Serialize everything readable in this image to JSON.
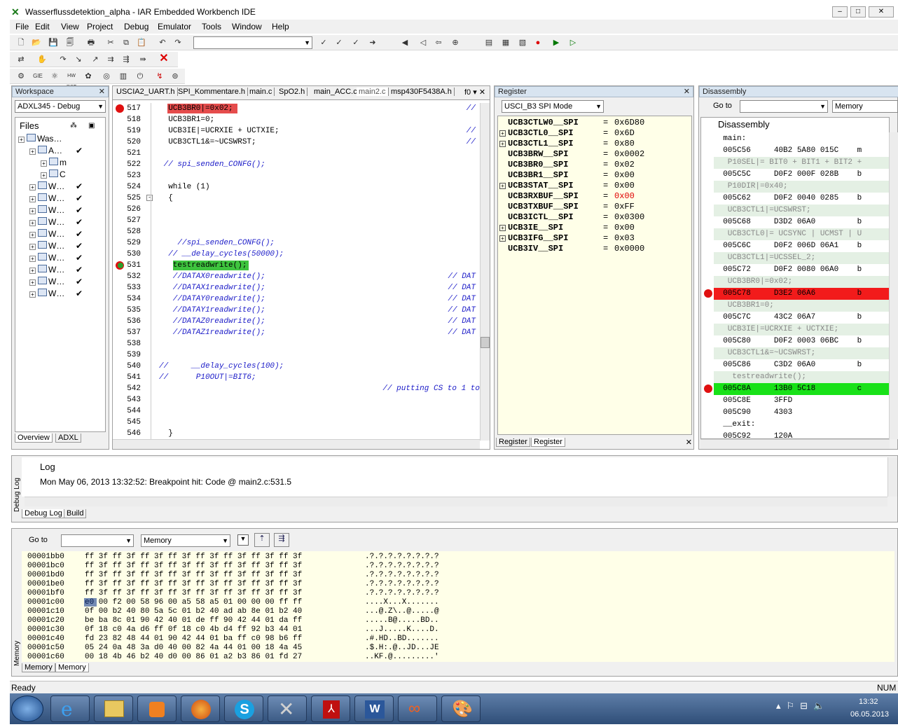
{
  "window": {
    "title": "Wasserflussdetektion_alpha - IAR Embedded Workbench IDE"
  },
  "menu": [
    "File",
    "Edit",
    "View",
    "Project",
    "Debug",
    "Emulator",
    "Tools",
    "Window",
    "Help"
  ],
  "workspace": {
    "header": "Workspace",
    "config": "ADXL345 - Debug",
    "files_label": "Files",
    "tree": [
      {
        "indent": 0,
        "label": "Was…",
        "check": ""
      },
      {
        "indent": 1,
        "label": "A…",
        "check": "✔"
      },
      {
        "indent": 2,
        "label": "m",
        "check": ""
      },
      {
        "indent": 2,
        "label": "C",
        "check": ""
      },
      {
        "indent": 1,
        "label": "W…",
        "check": "✔"
      },
      {
        "indent": 1,
        "label": "W…",
        "check": "✔"
      },
      {
        "indent": 1,
        "label": "W…",
        "check": "✔"
      },
      {
        "indent": 1,
        "label": "W…",
        "check": "✔"
      },
      {
        "indent": 1,
        "label": "W…",
        "check": "✔"
      },
      {
        "indent": 1,
        "label": "W…",
        "check": "✔"
      },
      {
        "indent": 1,
        "label": "W…",
        "check": "✔"
      },
      {
        "indent": 1,
        "label": "W…",
        "check": "✔"
      },
      {
        "indent": 1,
        "label": "W…",
        "check": "✔"
      },
      {
        "indent": 1,
        "label": "W…",
        "check": "✔"
      }
    ],
    "tabs": [
      "Overview",
      "ADXL"
    ]
  },
  "editor": {
    "tabs": [
      "USCIA2_UART.h",
      "SPI_Kommentare.h",
      "main.c",
      "SpO2.h",
      "main_ACC.c",
      "main2.c",
      "msp430F5438A.h"
    ],
    "active_tab": "main2.c",
    "func_label": "f0",
    "lines": [
      {
        "n": "517",
        "code": "  UCB3BR0|=0x02;",
        "cmt": "//",
        "mark": "bp"
      },
      {
        "n": "518",
        "code": "  UCB3BR1=0;",
        "cmt": "",
        "mark": ""
      },
      {
        "n": "519",
        "code": "  UCB3IE|=UCRXIE + UCTXIE;",
        "cmt": "//",
        "mark": ""
      },
      {
        "n": "520",
        "code": "  UCB3CTL1&=~UCSWRST;",
        "cmt": "//",
        "mark": ""
      },
      {
        "n": "521",
        "code": "",
        "cmt": "",
        "mark": ""
      },
      {
        "n": "522",
        "code": " // spi_senden_CONFG();",
        "cmt": "",
        "mark": ""
      },
      {
        "n": "523",
        "code": "",
        "cmt": "",
        "mark": ""
      },
      {
        "n": "524",
        "code": "  while (1)",
        "cmt": "",
        "mark": ""
      },
      {
        "n": "525",
        "code": "  {",
        "cmt": "",
        "mark": ""
      },
      {
        "n": "526",
        "code": "",
        "cmt": "",
        "mark": ""
      },
      {
        "n": "527",
        "code": "",
        "cmt": "",
        "mark": ""
      },
      {
        "n": "528",
        "code": "",
        "cmt": "",
        "mark": ""
      },
      {
        "n": "529",
        "code": "    //spi_senden_CONFG();",
        "cmt": "",
        "mark": ""
      },
      {
        "n": "530",
        "code": "  // __delay_cycles(50000);",
        "cmt": "",
        "mark": ""
      },
      {
        "n": "531",
        "code": "   testreadwrite();",
        "cmt": "",
        "mark": "pc"
      },
      {
        "n": "532",
        "code": "   //DATAX0readwrite();",
        "cmt": "// DAT",
        "mark": ""
      },
      {
        "n": "533",
        "code": "   //DATAX1readwrite();",
        "cmt": "// DAT",
        "mark": ""
      },
      {
        "n": "534",
        "code": "   //DATAY0readwrite();",
        "cmt": "// DAT",
        "mark": ""
      },
      {
        "n": "535",
        "code": "   //DATAY1readwrite();",
        "cmt": "// DAT",
        "mark": ""
      },
      {
        "n": "536",
        "code": "   //DATAZ0readwrite();",
        "cmt": "// DAT",
        "mark": ""
      },
      {
        "n": "537",
        "code": "   //DATAZ1readwrite();",
        "cmt": "// DAT",
        "mark": ""
      },
      {
        "n": "538",
        "code": "",
        "cmt": "",
        "mark": ""
      },
      {
        "n": "539",
        "code": "",
        "cmt": "",
        "mark": ""
      },
      {
        "n": "540",
        "code": "//     __delay_cycles(100);",
        "cmt": "",
        "mark": ""
      },
      {
        "n": "541",
        "code": "//      P10OUT|=BIT6;",
        "cmt": "",
        "mark": ""
      },
      {
        "n": "542",
        "code": "",
        "cmt": "// putting CS to 1 to",
        "mark": ""
      },
      {
        "n": "543",
        "code": "",
        "cmt": "",
        "mark": ""
      },
      {
        "n": "544",
        "code": "",
        "cmt": "",
        "mark": ""
      },
      {
        "n": "545",
        "code": "",
        "cmt": "",
        "mark": ""
      },
      {
        "n": "546",
        "code": "  }",
        "cmt": "",
        "mark": ""
      }
    ]
  },
  "register": {
    "header": "Register",
    "mode": "USCI_B3 SPI Mode",
    "rows": [
      {
        "name": "UCB3CTLW0__SPI",
        "val": "0x6D80",
        "exp": false,
        "red": false
      },
      {
        "name": "UCB3CTL0__SPI",
        "val": "0x6D",
        "exp": true,
        "red": false
      },
      {
        "name": "UCB3CTL1__SPI",
        "val": "0x80",
        "exp": true,
        "red": false
      },
      {
        "name": "UCB3BRW__SPI",
        "val": "0x0002",
        "exp": false,
        "red": false
      },
      {
        "name": "UCB3BR0__SPI",
        "val": "0x02",
        "exp": false,
        "red": false
      },
      {
        "name": "UCB3BR1__SPI",
        "val": "0x00",
        "exp": false,
        "red": false
      },
      {
        "name": "UCB3STAT__SPI",
        "val": "0x00",
        "exp": true,
        "red": false
      },
      {
        "name": "UCB3RXBUF__SPI",
        "val": "0x00",
        "exp": false,
        "red": true
      },
      {
        "name": "UCB3TXBUF__SPI",
        "val": "0xFF",
        "exp": false,
        "red": false
      },
      {
        "name": "UCB3ICTL__SPI",
        "val": "0x0300",
        "exp": false,
        "red": false
      },
      {
        "name": "UCB3IE__SPI",
        "val": "0x00",
        "exp": true,
        "red": false
      },
      {
        "name": "UCB3IFG__SPI",
        "val": "0x03",
        "exp": true,
        "red": false
      },
      {
        "name": "UCB3IV__SPI",
        "val": "0x0000",
        "exp": false,
        "red": false
      }
    ],
    "tabs": [
      "Register",
      "Register"
    ]
  },
  "disassembly": {
    "header": "Disassembly",
    "goto_label": "Go to",
    "memory_label": "Memory",
    "title": "Disassembly",
    "rows": [
      {
        "t": "  main:",
        "kind": "label"
      },
      {
        "t": "  005C56     40B2 5A80 015C    m",
        "kind": "code"
      },
      {
        "t": "   P10SEL|= BIT0 + BIT1 + BIT2 +",
        "kind": "src"
      },
      {
        "t": "  005C5C     D0F2 000F 028B    b",
        "kind": "code"
      },
      {
        "t": "   P10DIR|=0x40;",
        "kind": "src"
      },
      {
        "t": "  005C62     D0F2 0040 0285    b",
        "kind": "code"
      },
      {
        "t": "   UCB3CTL1|=UCSWRST;",
        "kind": "src"
      },
      {
        "t": "  005C68     D3D2 06A0         b",
        "kind": "code"
      },
      {
        "t": "   UCB3CTL0|= UCSYNC | UCMST | U",
        "kind": "src"
      },
      {
        "t": "  005C6C     D0F2 006D 06A1    b",
        "kind": "code"
      },
      {
        "t": "   UCB3CTL1|=UCSSEL_2;",
        "kind": "src"
      },
      {
        "t": "  005C72     D0F2 0080 06A0    b",
        "kind": "code"
      },
      {
        "t": "   UCB3BR0|=0x02;",
        "kind": "src"
      },
      {
        "t": "  005C78     D3E2 06A6         b",
        "kind": "bp"
      },
      {
        "t": "   UCB3BR1=0;",
        "kind": "src"
      },
      {
        "t": "  005C7C     43C2 06A7         b",
        "kind": "code"
      },
      {
        "t": "   UCB3IE|=UCRXIE + UCTXIE;",
        "kind": "src"
      },
      {
        "t": "  005C80     D0F2 0003 06BC    b",
        "kind": "code"
      },
      {
        "t": "   UCB3CTL1&=~UCSWRST;",
        "kind": "src"
      },
      {
        "t": "  005C86     C3D2 06A0         b",
        "kind": "code"
      },
      {
        "t": "    testreadwrite();",
        "kind": "src"
      },
      {
        "t": "  005C8A     13B0 5C18         c",
        "kind": "pc"
      },
      {
        "t": "  005C8E     3FFD",
        "kind": "code"
      },
      {
        "t": "  005C90     4303",
        "kind": "code"
      },
      {
        "t": "  __exit:",
        "kind": "label"
      },
      {
        "t": "  005C92     120A",
        "kind": "code"
      }
    ]
  },
  "log": {
    "title": "Log",
    "message": "Mon May 06, 2013 13:32:52: Breakpoint hit: Code @ main2.c:531.5",
    "side_label": "Debug Log",
    "tabs": [
      "Debug Log",
      "Build"
    ]
  },
  "memory": {
    "goto_label": "Go to",
    "zone": "Memory",
    "side_label": "Memory",
    "rows": [
      {
        "a": "00001bb0",
        "h": "ff 3f ff 3f ff 3f ff 3f ff 3f ff 3f ff 3f ff 3f",
        "s": ".?.?.?.?.?.?.?.?"
      },
      {
        "a": "00001bc0",
        "h": "ff 3f ff 3f ff 3f ff 3f ff 3f ff 3f ff 3f ff 3f",
        "s": ".?.?.?.?.?.?.?.?"
      },
      {
        "a": "00001bd0",
        "h": "ff 3f ff 3f ff 3f ff 3f ff 3f ff 3f ff 3f ff 3f",
        "s": ".?.?.?.?.?.?.?.?"
      },
      {
        "a": "00001be0",
        "h": "ff 3f ff 3f ff 3f ff 3f ff 3f ff 3f ff 3f ff 3f",
        "s": ".?.?.?.?.?.?.?.?"
      },
      {
        "a": "00001bf0",
        "h": "ff 3f ff 3f ff 3f ff 3f ff 3f ff 3f ff 3f ff 3f",
        "s": ".?.?.?.?.?.?.?.?"
      },
      {
        "a": "00001c00",
        "h": "e0 00 f2 00 58 96 00 a5 58 a5 01 00 00 00 ff ff",
        "s": "....X...X......."
      },
      {
        "a": "00001c10",
        "h": "0f 00 b2 40 80 5a 5c 01 b2 40 ad ab 8e 01 b2 40",
        "s": "...@.Z\\..@.....@"
      },
      {
        "a": "00001c20",
        "h": "be ba 8c 01 90 42 40 01 de ff 90 42 44 01 da ff",
        "s": ".....B@.....BD.."
      },
      {
        "a": "00001c30",
        "h": "0f 18 c0 4a d6 ff 0f 18 c0 4b d4 ff 92 b3 44 01",
        "s": "...J.....K....D."
      },
      {
        "a": "00001c40",
        "h": "fd 23 82 48 44 01 90 42 44 01 ba ff c0 98 b6 ff",
        "s": ".#.HD..BD......."
      },
      {
        "a": "00001c50",
        "h": "05 24 0a 48 3a d0 40 00 82 4a 44 01 00 18 4a 45",
        "s": ".$.H:.@..JD...JE"
      },
      {
        "a": "00001c60",
        "h": "00 18 4b 46 b2 40 d0 00 86 01 a2 b3 86 01 fd 27",
        "s": "..KF.@.........'"
      }
    ],
    "tabs": [
      "Memory",
      "Memory"
    ]
  },
  "status": {
    "left": "Ready",
    "right": "NUM"
  },
  "taskbar": {
    "time": "13:32",
    "date": "06.05.2013"
  }
}
